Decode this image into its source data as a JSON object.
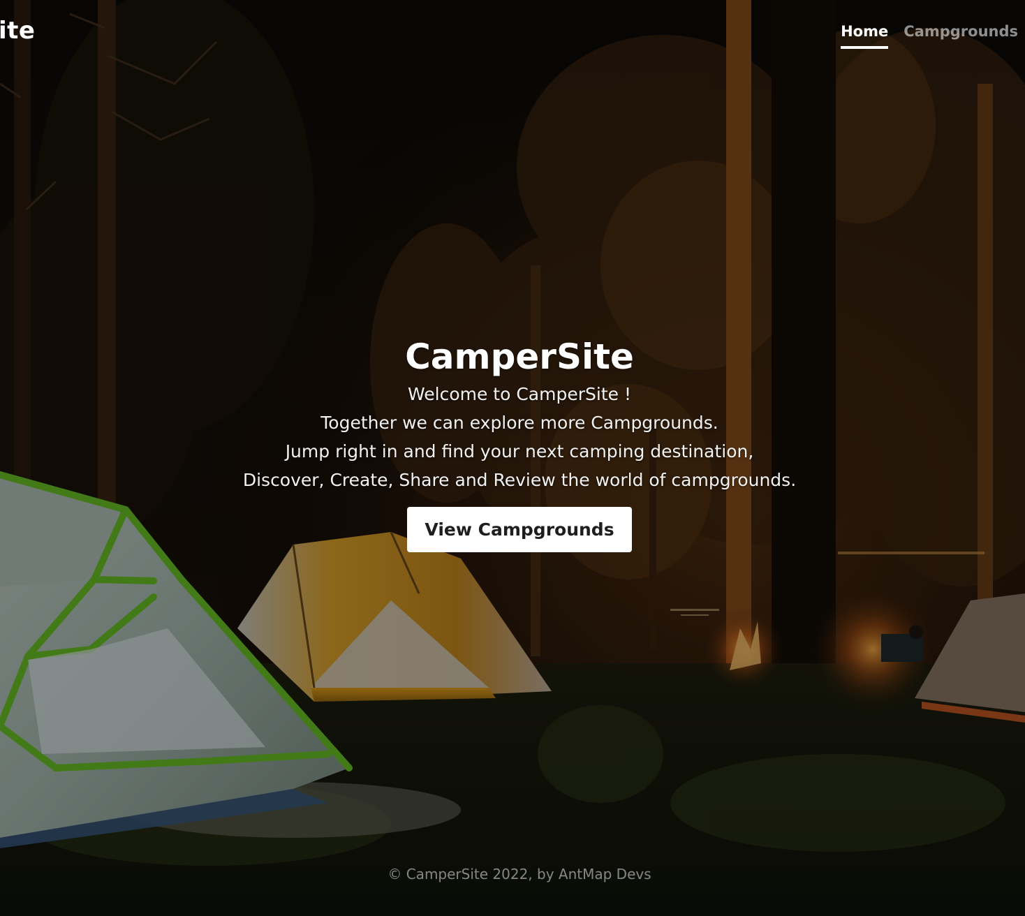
{
  "navbar": {
    "brand_visible": "ite",
    "links": [
      {
        "label": "Home",
        "active": true
      },
      {
        "label": "Campgrounds",
        "active": false
      }
    ]
  },
  "hero": {
    "title": "CamperSite",
    "lines": [
      "Welcome to CamperSite !",
      "Together we can explore more Campgrounds.",
      "Jump right in and find your next camping destination,",
      "Discover, Create, Share and Review the world of campgrounds."
    ],
    "cta_label": "View Campgrounds"
  },
  "footer": {
    "text": "© CamperSite 2022, by AntMap Devs"
  },
  "colors": {
    "overlay": "#000000",
    "text": "#ffffff",
    "button_bg": "#ffffff",
    "button_text": "#1e1e1e",
    "tent_green": "#7ec832",
    "tent_orange": "#e6a21c"
  }
}
